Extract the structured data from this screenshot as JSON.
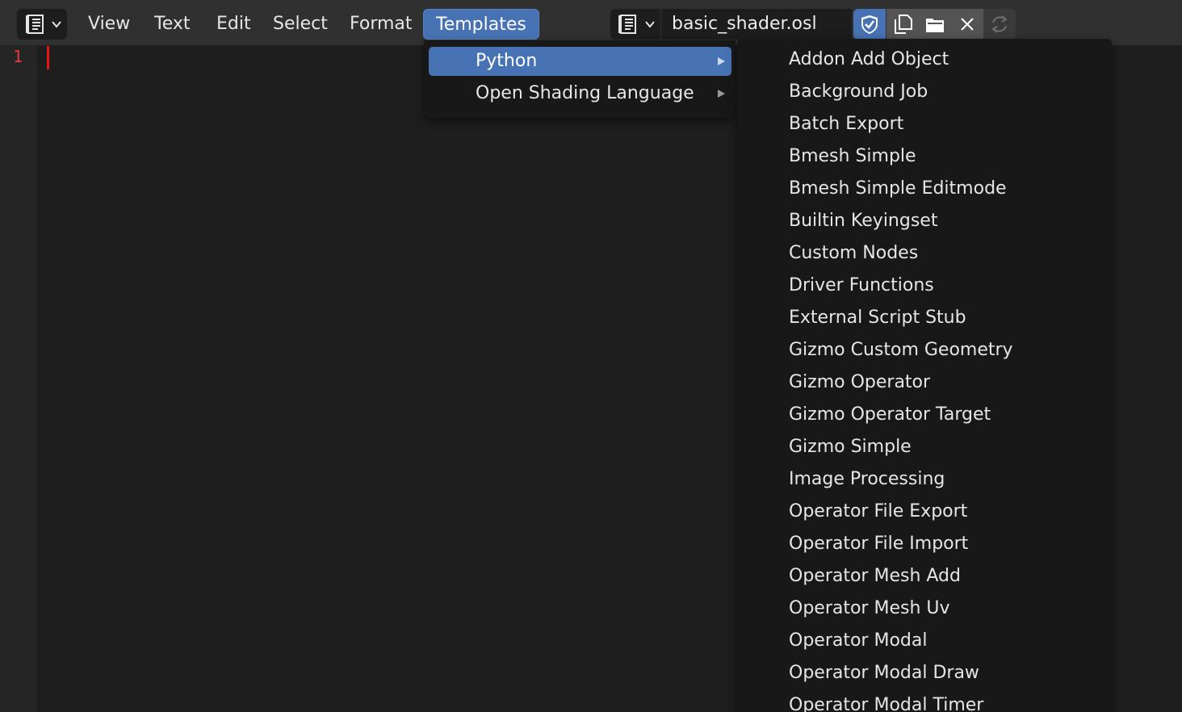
{
  "header": {
    "editor_type_icon": "text-editor-icon",
    "menus": [
      "View",
      "Text",
      "Edit",
      "Select",
      "Format",
      "Templates"
    ],
    "active_menu": "Templates",
    "textblock_icon": "text-document-icon",
    "filename": "basic_shader.osl",
    "buttons": [
      "fake-user-shield-icon",
      "new-file-icon",
      "open-folder-icon",
      "unlink-x-icon",
      "reload-icon"
    ]
  },
  "editor": {
    "line_number": "1"
  },
  "templates_menu": {
    "items": [
      {
        "label": "Python",
        "has_submenu": true,
        "highlighted": true
      },
      {
        "label": "Open Shading Language",
        "has_submenu": true,
        "highlighted": false
      }
    ]
  },
  "python_submenu": {
    "items": [
      "Addon Add Object",
      "Background Job",
      "Batch Export",
      "Bmesh Simple",
      "Bmesh Simple Editmode",
      "Builtin Keyingset",
      "Custom Nodes",
      "Driver Functions",
      "External Script Stub",
      "Gizmo Custom Geometry",
      "Gizmo Operator",
      "Gizmo Operator Target",
      "Gizmo Simple",
      "Image Processing",
      "Operator File Export",
      "Operator File Import",
      "Operator Mesh Add",
      "Operator Mesh Uv",
      "Operator Modal",
      "Operator Modal Draw",
      "Operator Modal Timer"
    ]
  },
  "colors": {
    "accent": "#4772b3",
    "line_number": "#e23b3b",
    "cursor": "#e21616"
  }
}
